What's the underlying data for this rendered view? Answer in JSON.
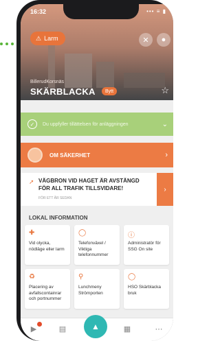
{
  "status": {
    "time": "16:32",
    "icons": "••• ≡ ▮"
  },
  "header": {
    "alarm_label": "Larm",
    "subtitle": "BillerudKorsnäs",
    "title": "SKÄRBLACKA",
    "badge": "Bytt"
  },
  "banners": {
    "notice": "Du uppfyller tillättelsen för anläggningen",
    "safety": "OM SÄKERHET"
  },
  "news": {
    "title": "VÄGBRON VID HAGET ÄR AVSTÄNGD FÖR ALL TRAFIK TILLSVIDARE!",
    "meta": "FÖR ETT ÅR SEDAN"
  },
  "section": {
    "title": "LOKAL INFORMATION"
  },
  "cards": [
    {
      "label": "Vid olycka, nödläge eller larm",
      "icon": "plus-box-icon"
    },
    {
      "label": "Telefonväxel / Viktiga telefonnummer",
      "icon": "chat-icon"
    },
    {
      "label": "Administratör för SSG On site",
      "icon": "info-icon"
    },
    {
      "label": "Placering av avfallscontainrar och portnummer",
      "icon": "recycle-icon"
    },
    {
      "label": "Lunchmeny Strömporten",
      "icon": "cutlery-icon"
    },
    {
      "label": "HSO Skärblacka bruk",
      "icon": "chat-icon"
    }
  ],
  "colors": {
    "accent": "#e8743b",
    "green": "#a8d07a",
    "teal": "#2fb8b3"
  }
}
